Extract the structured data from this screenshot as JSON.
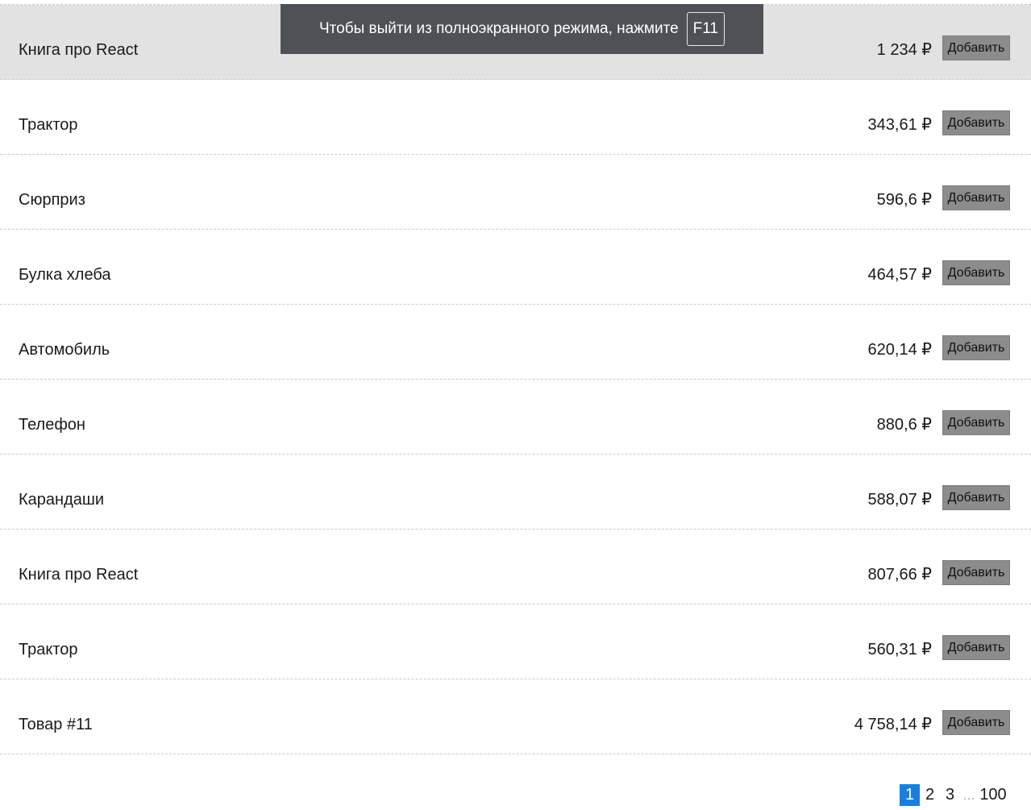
{
  "products": [
    {
      "title": "Книга про React",
      "price": "1 234 ₽",
      "add_label": "Добавить"
    },
    {
      "title": "Трактор",
      "price": "343,61 ₽",
      "add_label": "Добавить"
    },
    {
      "title": "Сюрприз",
      "price": "596,6 ₽",
      "add_label": "Добавить"
    },
    {
      "title": "Булка хлеба",
      "price": "464,57 ₽",
      "add_label": "Добавить"
    },
    {
      "title": "Автомобиль",
      "price": "620,14 ₽",
      "add_label": "Добавить"
    },
    {
      "title": "Телефон",
      "price": "880,6 ₽",
      "add_label": "Добавить"
    },
    {
      "title": "Карандаши",
      "price": "588,07 ₽",
      "add_label": "Добавить"
    },
    {
      "title": "Книга про React",
      "price": "807,66 ₽",
      "add_label": "Добавить"
    },
    {
      "title": "Трактор",
      "price": "560,31 ₽",
      "add_label": "Добавить"
    },
    {
      "title": "Товар #11",
      "price": "4 758,14 ₽",
      "add_label": "Добавить"
    }
  ],
  "pagination": {
    "pages": [
      "1",
      "2",
      "3"
    ],
    "ellipsis": "...",
    "last": "100",
    "current": "1"
  },
  "fullscreen_banner": {
    "text": "Чтобы выйти из полноэкранного режима, нажмите",
    "key": "F11"
  },
  "colors": {
    "selected_row": "#e2e2e2",
    "button_bg": "#8c8c8c",
    "active_page": "#1a7fdc",
    "banner_bg": "#4e5155"
  }
}
